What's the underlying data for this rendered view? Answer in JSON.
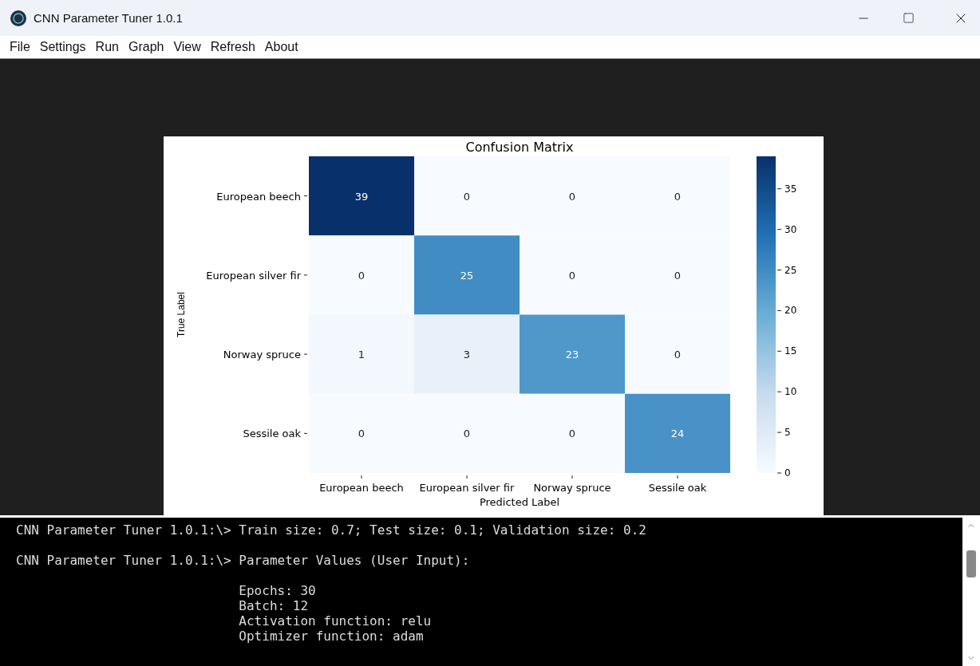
{
  "window": {
    "title": "CNN Parameter Tuner 1.0.1"
  },
  "menu": [
    "File",
    "Settings",
    "Run",
    "Graph",
    "View",
    "Refresh",
    "About"
  ],
  "matrix": {
    "title": "Confusion Matrix",
    "xlabel": "Predicted Label",
    "ylabel": "True Label",
    "row_labels": [
      "European beech",
      "European silver fir",
      "Norway spruce",
      "Sessile oak"
    ],
    "column_labels": [
      "European beech",
      "European silver fir",
      "Norway spruce",
      "Sessile oak"
    ],
    "cells": [
      [
        "39",
        "0",
        "0",
        "0"
      ],
      [
        "0",
        "25",
        "0",
        "0"
      ],
      [
        "1",
        "3",
        "23",
        "0"
      ],
      [
        "0",
        "0",
        "0",
        "24"
      ]
    ],
    "colorbar_ticks": [
      "35",
      "30",
      "25",
      "20",
      "15",
      "10",
      "5",
      "0"
    ]
  },
  "console": {
    "lines": [
      {
        "kind": "prompt",
        "prompt": "CNN Parameter Tuner 1.0.1:\\>",
        "text": "Train size: 0.7; Test size: 0.1; Validation size: 0.2"
      },
      {
        "kind": "prompt",
        "prompt": "CNN Parameter Tuner 1.0.1:\\>",
        "text": "Parameter Values (User Input):"
      },
      {
        "kind": "detail",
        "text": "Epochs: 30"
      },
      {
        "kind": "detail",
        "text": "Batch: 12"
      },
      {
        "kind": "detail",
        "text": "Activation function: relu"
      },
      {
        "kind": "detail",
        "text": "Optimizer function: adam"
      }
    ]
  }
}
